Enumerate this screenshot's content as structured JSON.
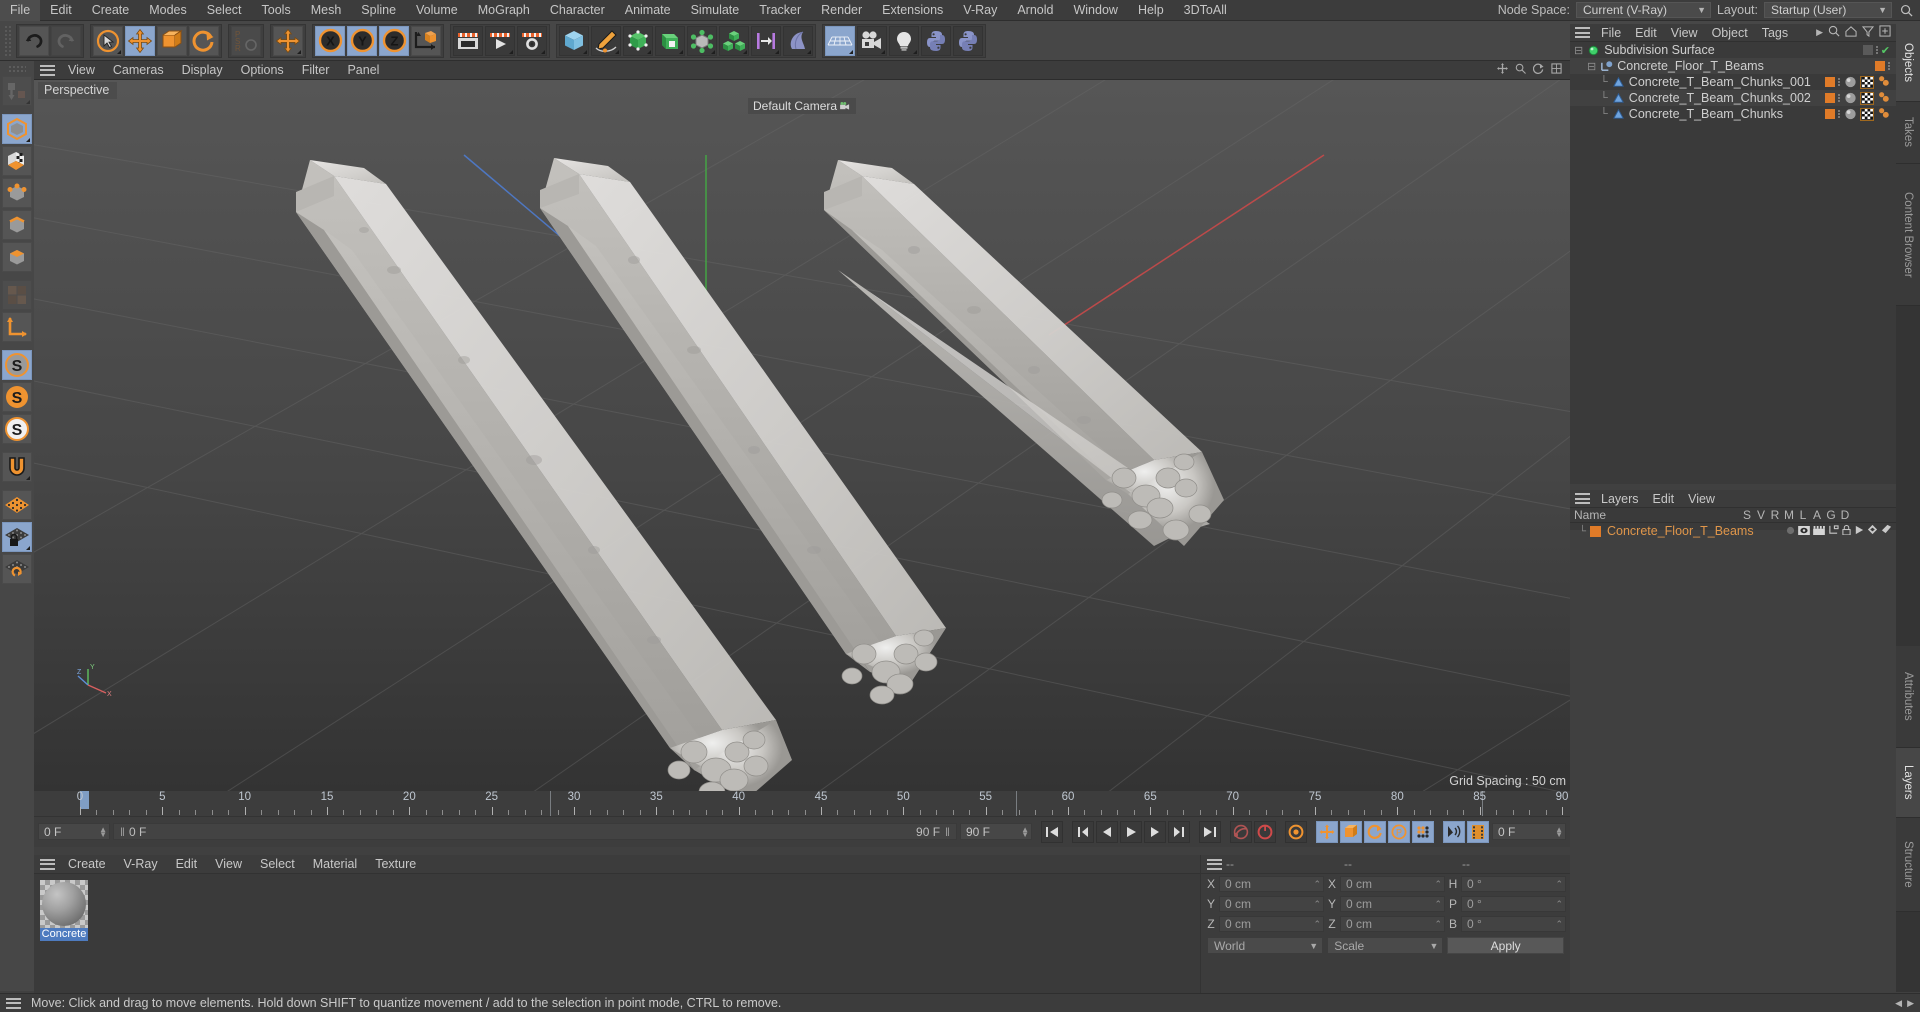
{
  "menubar": {
    "items": [
      "File",
      "Edit",
      "Create",
      "Modes",
      "Select",
      "Tools",
      "Mesh",
      "Spline",
      "Volume",
      "MoGraph",
      "Character",
      "Animate",
      "Simulate",
      "Tracker",
      "Render",
      "Extensions",
      "V-Ray",
      "Arnold",
      "Window",
      "Help",
      "3DToAll"
    ],
    "node_space_label": "Node Space:",
    "node_space_value": "Current (V-Ray)",
    "layout_label": "Layout:",
    "layout_value": "Startup (User)",
    "search_icon": "search-icon"
  },
  "toolbar": {
    "groups": [
      {
        "name": "history",
        "buttons": [
          {
            "icon": "undo-icon",
            "label": "Undo",
            "state": "normal"
          },
          {
            "icon": "redo-icon",
            "label": "Redo",
            "state": "disabled"
          }
        ]
      },
      {
        "name": "transform",
        "buttons": [
          {
            "icon": "select-cursor-icon",
            "label": "Live Selection",
            "state": "normal"
          },
          {
            "icon": "move-icon",
            "label": "Move",
            "state": "active"
          },
          {
            "icon": "scale-icon",
            "label": "Scale",
            "state": "normal"
          },
          {
            "icon": "rotate-icon",
            "label": "Rotate",
            "state": "normal"
          }
        ]
      },
      {
        "name": "psr",
        "buttons": [
          {
            "icon": "psr-icon",
            "label": "PSR",
            "state": "disabled"
          }
        ]
      },
      {
        "name": "moveworld",
        "buttons": [
          {
            "icon": "move-world-icon",
            "label": "Move World",
            "state": "normal"
          }
        ]
      },
      {
        "name": "axes",
        "buttons": [
          {
            "icon": "axis-x-icon",
            "label": "X Axis",
            "state": "active"
          },
          {
            "icon": "axis-y-icon",
            "label": "Y Axis",
            "state": "active"
          },
          {
            "icon": "axis-z-icon",
            "label": "Z Axis",
            "state": "active"
          },
          {
            "icon": "world-object-coord-icon",
            "label": "World/Object",
            "state": "normal"
          }
        ]
      },
      {
        "name": "render",
        "buttons": [
          {
            "icon": "render-view-icon",
            "label": "Render View",
            "state": "dark"
          },
          {
            "icon": "render-picture-viewer-icon",
            "label": "Render to Picture Viewer",
            "state": "dark"
          },
          {
            "icon": "render-settings-icon",
            "label": "Render Settings",
            "state": "dark"
          }
        ]
      },
      {
        "name": "create",
        "buttons": [
          {
            "icon": "cube-primitive-icon",
            "label": "Cube",
            "state": "dark"
          },
          {
            "icon": "pen-spline-icon",
            "label": "Pen",
            "state": "dark"
          },
          {
            "icon": "nurbs-icon",
            "label": "Subdivision Surface",
            "state": "dark"
          },
          {
            "icon": "generator-icon",
            "label": "Array",
            "state": "dark"
          },
          {
            "icon": "deformer-icon",
            "label": "Bend Deformer",
            "state": "dark"
          },
          {
            "icon": "mograph-cloner-icon",
            "label": "MoGraph Cloner",
            "state": "dark"
          },
          {
            "icon": "field-icon",
            "label": "Field",
            "state": "dark"
          },
          {
            "icon": "environment-icon",
            "label": "Environment",
            "state": "dark"
          }
        ]
      },
      {
        "name": "scene",
        "buttons": [
          {
            "icon": "floor-icon",
            "label": "Floor",
            "state": "dark"
          },
          {
            "icon": "camera-icon",
            "label": "Camera",
            "state": "dark"
          },
          {
            "icon": "light-icon",
            "label": "Light",
            "state": "dark"
          },
          {
            "icon": "python-icon",
            "label": "Python Generator",
            "state": "dark"
          },
          {
            "icon": "python-tag-icon",
            "label": "Python Tag",
            "state": "dark"
          }
        ]
      }
    ]
  },
  "lefttools": {
    "buttons": [
      {
        "icon": "make-editable-icon",
        "label": "Make Editable",
        "state": "disabled"
      },
      {
        "icon": "model-mode-icon",
        "label": "Model Mode",
        "state": "active"
      },
      {
        "icon": "texture-mode-icon",
        "label": "Texture Mode",
        "state": "normal"
      },
      {
        "icon": "points-mode-icon",
        "label": "Points Mode",
        "state": "normal"
      },
      {
        "icon": "edges-mode-icon",
        "label": "Edges Mode",
        "state": "normal"
      },
      {
        "icon": "polygons-mode-icon",
        "label": "Polygons Mode",
        "state": "normal"
      },
      {
        "icon": "uv-mode-icon",
        "label": "UV Mode",
        "state": "disabled"
      },
      {
        "icon": "axis-modify-icon",
        "label": "Enable Axis Modification",
        "state": "normal"
      },
      {
        "icon": "snap-enable-icon",
        "label": "Enable Snapping",
        "state": "active"
      },
      {
        "icon": "snap-settings-icon",
        "label": "Snap Settings",
        "state": "normal"
      },
      {
        "icon": "snap-mode-icon",
        "label": "Snap Mode",
        "state": "normal"
      },
      {
        "icon": "magnet-icon",
        "label": "Magnet",
        "state": "normal"
      },
      {
        "icon": "workplane-icon",
        "label": "Workplane",
        "state": "normal"
      },
      {
        "icon": "workplane-lock-icon",
        "label": "Lock Workplane",
        "state": "active"
      },
      {
        "icon": "workplane-reset-icon",
        "label": "Reset Workplane",
        "state": "normal"
      }
    ]
  },
  "viewport": {
    "menu": [
      "View",
      "Cameras",
      "Display",
      "Options",
      "Filter",
      "Panel"
    ],
    "hamburger_icon": "hamburger-icon",
    "corner_icons": [
      "move-gizmo-icon",
      "zoom-gizmo-icon",
      "rotate-gizmo-icon",
      "maximize-icon"
    ],
    "perspective_label": "Perspective",
    "camera_label": "Default Camera",
    "camera_icon": "camera-small-icon",
    "grid_spacing": "Grid Spacing : 50 cm",
    "axis_labels": {
      "x": "X",
      "y": "Y",
      "z": "Z"
    },
    "objects_note": "Three broken concrete T-beam models on grid"
  },
  "timeline": {
    "ticks": [
      0,
      5,
      10,
      15,
      20,
      25,
      30,
      35,
      40,
      45,
      50,
      55,
      60,
      65,
      70,
      75,
      80,
      85,
      90
    ],
    "range_start": 0,
    "range_end": 90,
    "current_frame": "0 F",
    "current_frame_secondary": "0 F",
    "end_frame_track": "90 F",
    "end_frame_field": "90 F",
    "preview_field": "0 F",
    "transport": [
      {
        "icon": "go-to-start-icon",
        "label": "Go to Start",
        "state": "normal"
      },
      {
        "icon": "previous-key-icon",
        "label": "Go to Previous Key",
        "state": "normal"
      },
      {
        "icon": "previous-frame-icon",
        "label": "Go to Previous Frame",
        "state": "normal"
      },
      {
        "icon": "play-icon",
        "label": "Play",
        "state": "normal"
      },
      {
        "icon": "next-frame-icon",
        "label": "Go to Next Frame",
        "state": "normal"
      },
      {
        "icon": "next-key-icon",
        "label": "Go to Next Key",
        "state": "normal"
      },
      {
        "icon": "go-to-end-icon",
        "label": "Go to End",
        "state": "normal"
      },
      {
        "icon": "record-active-objects-icon",
        "label": "Record Active Objects",
        "state": "normal"
      },
      {
        "icon": "autokey-icon",
        "label": "Autokeying",
        "state": "normal"
      },
      {
        "icon": "keyframe-selection-icon",
        "label": "Keyframe Selection",
        "state": "normal"
      },
      {
        "icon": "position-key-icon",
        "label": "Position",
        "state": "active"
      },
      {
        "icon": "scale-key-icon",
        "label": "Scale",
        "state": "active"
      },
      {
        "icon": "rotation-key-icon",
        "label": "Rotation",
        "state": "active"
      },
      {
        "icon": "param-key-icon",
        "label": "Parameter",
        "state": "active"
      },
      {
        "icon": "pla-key-icon",
        "label": "Point Level Animation",
        "state": "active"
      },
      {
        "icon": "sound-icon",
        "label": "Sound",
        "state": "active"
      },
      {
        "icon": "filmstrip-icon",
        "label": "Preview Range",
        "state": "active"
      }
    ]
  },
  "material_manager": {
    "menu": [
      "Create",
      "V-Ray",
      "Edit",
      "View",
      "Select",
      "Material",
      "Texture"
    ],
    "hamburger_icon": "hamburger-icon",
    "materials": [
      {
        "name": "Concrete",
        "icon": "material-sphere-icon",
        "selected": true
      }
    ]
  },
  "coordinates": {
    "hamburger_icon": "hamburger-icon",
    "header_dashes": [
      "--",
      "--",
      "--"
    ],
    "rows": [
      {
        "axis": "X",
        "position": "0 cm",
        "axis2": "X",
        "size": "0 cm",
        "rot_axis": "H",
        "rot": "0 °"
      },
      {
        "axis": "Y",
        "position": "0 cm",
        "axis2": "Y",
        "size": "0 cm",
        "rot_axis": "P",
        "rot": "0 °"
      },
      {
        "axis": "Z",
        "position": "0 cm",
        "axis2": "Z",
        "size": "0 cm",
        "rot_axis": "B",
        "rot": "0 °"
      }
    ],
    "system_value": "World",
    "mode_value": "Scale",
    "apply_label": "Apply"
  },
  "object_manager": {
    "hamburger_icon": "hamburger-icon",
    "menu": [
      "File",
      "Edit",
      "View",
      "Object",
      "Tags"
    ],
    "overflow_icon": "chevron-right-icon",
    "icons": [
      "search-icon",
      "home-icon",
      "filter-icon",
      "add-icon"
    ],
    "rows": [
      {
        "name": "Subdivision Surface",
        "indent": 0,
        "obj_icon": "subdivision-surface-icon",
        "swatch": "none",
        "check": true
      },
      {
        "name": "Concrete_Floor_T_Beams",
        "indent": 1,
        "obj_icon": "null-object-icon",
        "swatch": "#e07b28",
        "tags": []
      },
      {
        "name": "Concrete_T_Beam_Chunks_001",
        "indent": 2,
        "obj_icon": "polygon-object-icon",
        "swatch": "#e07b28",
        "tags": [
          "material-tag",
          "uvw-tag",
          "phong-tag"
        ]
      },
      {
        "name": "Concrete_T_Beam_Chunks_002",
        "indent": 2,
        "obj_icon": "polygon-object-icon",
        "swatch": "#e07b28",
        "tags": [
          "material-tag",
          "uvw-tag",
          "phong-tag"
        ]
      },
      {
        "name": "Concrete_T_Beam_Chunks",
        "indent": 2,
        "obj_icon": "polygon-object-icon",
        "swatch": "#e07b28",
        "tags": [
          "material-tag",
          "uvw-tag",
          "phong-tag"
        ]
      }
    ]
  },
  "layer_manager": {
    "hamburger_icon": "hamburger-icon",
    "menu": [
      "Layers",
      "Edit",
      "View"
    ],
    "name_column": "Name",
    "columns": [
      "S",
      "V",
      "R",
      "M",
      "L",
      "A",
      "G",
      "D"
    ],
    "rows": [
      {
        "name": "Concrete_Floor_T_Beams",
        "color": "#e07b28"
      }
    ]
  },
  "vertical_tabs": {
    "top": [
      {
        "label": "Objects",
        "active": true
      },
      {
        "label": "Takes",
        "active": false
      },
      {
        "label": "Content Browser",
        "active": false
      }
    ],
    "bottom": [
      {
        "label": "Attributes",
        "active": false
      },
      {
        "label": "Layers",
        "active": true
      },
      {
        "label": "Structure",
        "active": false
      }
    ]
  },
  "statusbar": {
    "hamburger_icon": "hamburger-icon",
    "message": "Move: Click and drag to move elements. Hold down SHIFT to quantize movement / add to the selection in point mode, CTRL to remove."
  },
  "colors": {
    "accent_orange": "#e07b28",
    "active_blue": "#8ba6cd",
    "panel_bg": "#3a3a3a",
    "toolbar_bg": "#474747",
    "text": "#c8c8c8"
  }
}
